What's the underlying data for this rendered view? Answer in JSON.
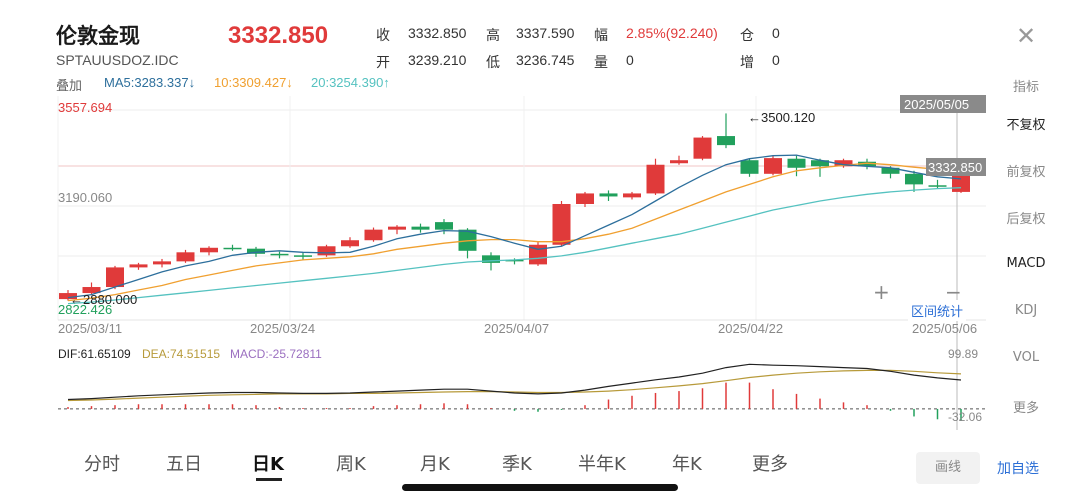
{
  "header": {
    "title": "伦敦金现",
    "code": "SPTAUUSDOZ.IDC",
    "price": "3332.850",
    "close_icon": "close-icon"
  },
  "stats": {
    "shou_label": "收",
    "shou": "3332.850",
    "gao_label": "高",
    "gao": "3337.590",
    "fu_label": "幅",
    "fu": "2.85%(92.240)",
    "cang_label": "仓",
    "cang": "0",
    "kai_label": "开",
    "kai": "3239.210",
    "di_label": "低",
    "di": "3236.745",
    "liang_label": "量",
    "liang": "0",
    "zeng_label": "增",
    "zeng": "0"
  },
  "indicators": {
    "overlay_label": "叠加",
    "ma5": "MA5:3283.337↓",
    "ma10": "10:3309.427↓",
    "ma20": "20:3254.390↑"
  },
  "side_menu": [
    "指标",
    "不复权",
    "前复权",
    "后复权",
    "MACD",
    "KDJ",
    "VOL",
    "更多"
  ],
  "zoom": {
    "plus": "+",
    "minus": "−",
    "range_stats": "区间统计"
  },
  "tabs": [
    "分时",
    "五日",
    "日K",
    "周K",
    "月K",
    "季K",
    "半年K",
    "年K",
    "更多"
  ],
  "active_tab": "日K",
  "buttons": {
    "draw": "画线",
    "add": "加自选"
  },
  "colors": {
    "up": "#e03a3a",
    "down": "#21a05c",
    "ma5": "#2d6f9c",
    "ma10": "#f0a030",
    "ma20": "#55c2c0",
    "dif": "#222222",
    "dea": "#b79a3a",
    "macd_label": "#9b6fc0"
  },
  "chart_data": [
    {
      "type": "candlestick",
      "title": "",
      "price_labels": {
        "top": "3557.694",
        "mid": "3190.060",
        "bottom": "2822.426"
      },
      "ylim": [
        2822.426,
        3557.694
      ],
      "annotations": {
        "high": "←3500.120",
        "low": "←2880.000",
        "current": "3332.850",
        "crosshair_date": "2025/05/05"
      },
      "dates": [
        "2025/03/11",
        "2025/03/24",
        "2025/04/07",
        "2025/04/22",
        "2025/05/06"
      ],
      "candles": [
        {
          "o": 2885,
          "c": 2905,
          "h": 2915,
          "l": 2880
        },
        {
          "o": 2905,
          "c": 2925,
          "h": 2940,
          "l": 2898
        },
        {
          "o": 2925,
          "c": 2990,
          "h": 2995,
          "l": 2918
        },
        {
          "o": 2990,
          "c": 3000,
          "h": 3005,
          "l": 2982
        },
        {
          "o": 3000,
          "c": 3010,
          "h": 3018,
          "l": 2990
        },
        {
          "o": 3010,
          "c": 3040,
          "h": 3048,
          "l": 3005
        },
        {
          "o": 3040,
          "c": 3055,
          "h": 3060,
          "l": 3030
        },
        {
          "o": 3055,
          "c": 3052,
          "h": 3065,
          "l": 3045
        },
        {
          "o": 3052,
          "c": 3035,
          "h": 3058,
          "l": 3025
        },
        {
          "o": 3035,
          "c": 3030,
          "h": 3042,
          "l": 3020
        },
        {
          "o": 3030,
          "c": 3025,
          "h": 3040,
          "l": 3015
        },
        {
          "o": 3030,
          "c": 3060,
          "h": 3065,
          "l": 3025
        },
        {
          "o": 3060,
          "c": 3080,
          "h": 3090,
          "l": 3055
        },
        {
          "o": 3080,
          "c": 3115,
          "h": 3122,
          "l": 3075
        },
        {
          "o": 3115,
          "c": 3125,
          "h": 3130,
          "l": 3100
        },
        {
          "o": 3125,
          "c": 3115,
          "h": 3135,
          "l": 3105
        },
        {
          "o": 3140,
          "c": 3115,
          "h": 3150,
          "l": 3100
        },
        {
          "o": 3115,
          "c": 3045,
          "h": 3120,
          "l": 3020
        },
        {
          "o": 3030,
          "c": 3005,
          "h": 3040,
          "l": 2980
        },
        {
          "o": 3015,
          "c": 3010,
          "h": 3020,
          "l": 3000
        },
        {
          "o": 3000,
          "c": 3065,
          "h": 3075,
          "l": 2995
        },
        {
          "o": 3065,
          "c": 3200,
          "h": 3210,
          "l": 3060
        },
        {
          "o": 3200,
          "c": 3235,
          "h": 3240,
          "l": 3190
        },
        {
          "o": 3235,
          "c": 3225,
          "h": 3245,
          "l": 3210
        },
        {
          "o": 3222,
          "c": 3235,
          "h": 3240,
          "l": 3215
        },
        {
          "o": 3235,
          "c": 3330,
          "h": 3350,
          "l": 3230
        },
        {
          "o": 3335,
          "c": 3345,
          "h": 3360,
          "l": 3330
        },
        {
          "o": 3350,
          "c": 3420,
          "h": 3425,
          "l": 3345
        },
        {
          "o": 3425,
          "c": 3395,
          "h": 3500,
          "l": 3385
        },
        {
          "o": 3345,
          "c": 3300,
          "h": 3352,
          "l": 3290
        },
        {
          "o": 3300,
          "c": 3352,
          "h": 3360,
          "l": 3295
        },
        {
          "o": 3350,
          "c": 3320,
          "h": 3360,
          "l": 3292
        },
        {
          "o": 3345,
          "c": 3325,
          "h": 3350,
          "l": 3290
        },
        {
          "o": 3325,
          "c": 3345,
          "h": 3350,
          "l": 3320
        },
        {
          "o": 3340,
          "c": 3325,
          "h": 3350,
          "l": 3315
        },
        {
          "o": 3320,
          "c": 3300,
          "h": 3325,
          "l": 3285
        },
        {
          "o": 3300,
          "c": 3265,
          "h": 3310,
          "l": 3240
        },
        {
          "o": 3262,
          "c": 3260,
          "h": 3280,
          "l": 3250
        },
        {
          "o": 3240,
          "c": 3332.85,
          "h": 3337.59,
          "l": 3236.745
        }
      ],
      "ma5": [
        2890,
        2900,
        2925,
        2950,
        2975,
        2995,
        3010,
        3030,
        3040,
        3045,
        3040,
        3038,
        3040,
        3060,
        3085,
        3100,
        3112,
        3110,
        3092,
        3070,
        3050,
        3060,
        3095,
        3130,
        3165,
        3210,
        3255,
        3295,
        3330,
        3350,
        3360,
        3362,
        3345,
        3330,
        3325,
        3320,
        3305,
        3290,
        3283
      ],
      "ma10": [
        2880,
        2888,
        2900,
        2915,
        2930,
        2950,
        2965,
        2980,
        2995,
        3005,
        3015,
        3020,
        3025,
        3035,
        3050,
        3060,
        3070,
        3078,
        3082,
        3082,
        3075,
        3075,
        3085,
        3100,
        3120,
        3150,
        3180,
        3210,
        3240,
        3265,
        3290,
        3310,
        3320,
        3328,
        3335,
        3330,
        3322,
        3315,
        3309
      ],
      "ma20": [
        2870,
        2875,
        2882,
        2890,
        2898,
        2906,
        2914,
        2922,
        2930,
        2938,
        2946,
        2954,
        2962,
        2970,
        2980,
        2990,
        3000,
        3008,
        3012,
        3015,
        3020,
        3028,
        3040,
        3055,
        3070,
        3085,
        3100,
        3120,
        3140,
        3160,
        3180,
        3195,
        3210,
        3222,
        3232,
        3240,
        3246,
        3251,
        3254
      ]
    },
    {
      "type": "bar",
      "title": "",
      "dif_label": "DIF:61.65109",
      "dea_label": "DEA:74.51515",
      "macd_label": "MACD:-25.72811",
      "top_label": "99.89",
      "bottom_label": "-32.06",
      "ylim": [
        -32.06,
        99.89
      ],
      "dif": [
        20,
        22,
        25,
        28,
        30,
        32,
        34,
        35,
        35,
        34,
        33,
        33,
        34,
        36,
        38,
        40,
        42,
        42,
        38,
        34,
        32,
        34,
        40,
        48,
        55,
        62,
        68,
        76,
        88,
        95,
        93,
        92,
        90,
        88,
        86,
        80,
        72,
        66,
        61.65
      ],
      "dea": [
        18,
        19,
        21,
        23,
        25,
        27,
        29,
        30,
        31,
        32,
        32,
        32,
        33,
        33,
        34,
        35,
        36,
        37,
        37,
        36,
        35,
        35,
        36,
        38,
        41,
        45,
        49,
        54,
        60,
        67,
        72,
        76,
        79,
        81,
        82,
        82,
        80,
        77,
        74.5
      ],
      "macd": [
        4,
        6,
        8,
        10,
        10,
        10,
        10,
        10,
        8,
        4,
        2,
        2,
        2,
        6,
        8,
        10,
        12,
        10,
        2,
        -4,
        -6,
        -2,
        8,
        20,
        28,
        34,
        38,
        44,
        56,
        56,
        42,
        32,
        22,
        14,
        8,
        -4,
        -16,
        -22,
        -25.7
      ]
    }
  ]
}
